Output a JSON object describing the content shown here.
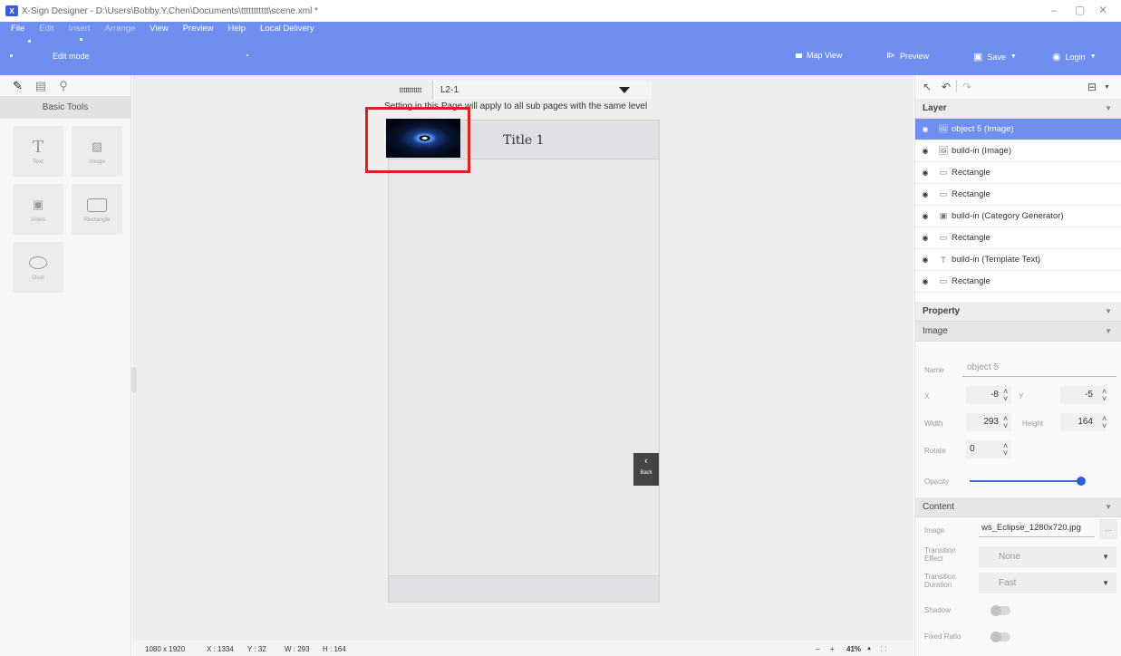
{
  "window": {
    "title": "X-Sign Designer - D:\\Users\\Bobby.Y.Chen\\Documents\\ttttttttttt\\scene.xml *",
    "controls": {
      "minimize": "–",
      "maximize": "▢",
      "close": "✕"
    }
  },
  "menu": {
    "items": [
      "File",
      "Edit",
      "Insert",
      "Arrange",
      "View",
      "Preview",
      "Help",
      "Local Delivery"
    ],
    "mode_label": "Edit mode"
  },
  "header_actions": {
    "map_view": "Map View",
    "preview": "Preview",
    "save": "Save",
    "login": "Login"
  },
  "toolbox": {
    "section_title": "Basic Tools",
    "tools": [
      "Text",
      "Image",
      "Video",
      "Rectangle",
      "Oval"
    ]
  },
  "canvas": {
    "page_prefix": "ttttttttttt",
    "page_selected": "L2-1",
    "note": "Setting in this Page will apply to all sub pages with the same level",
    "phone_title": "Title 1",
    "back_label": "Back"
  },
  "statusbar": {
    "resolution": "1080 x 1920",
    "x": "X : 1334",
    "y": "Y : 32",
    "w": "W : 293",
    "h": "H : 164",
    "zoom_minus": "–",
    "zoom_plus": "+",
    "zoom": "41%",
    "zoom_up": "▲",
    "fit": "⛶"
  },
  "layer_panel": {
    "title": "Layer",
    "layers": [
      {
        "name": "object 5 (Image)",
        "icon": "🖼",
        "selected": true
      },
      {
        "name": "build-in (Image)",
        "icon": "🖼",
        "selected": false
      },
      {
        "name": "Rectangle",
        "icon": "▭",
        "selected": false
      },
      {
        "name": "Rectangle",
        "icon": "▭",
        "selected": false
      },
      {
        "name": "build-in (Category Generator)",
        "icon": "▣",
        "selected": false
      },
      {
        "name": "Rectangle",
        "icon": "▭",
        "selected": false
      },
      {
        "name": "build-in (Template Text)",
        "icon": "T",
        "selected": false
      },
      {
        "name": "Rectangle",
        "icon": "▭",
        "selected": false
      }
    ]
  },
  "property_panel": {
    "title": "Property",
    "image_section": "Image",
    "name_label": "Name",
    "name_value": "object 5",
    "x_label": "X",
    "x_value": "-8",
    "y_label": "Y",
    "y_value": "-5",
    "width_label": "Width",
    "width_value": "293",
    "height_label": "Height",
    "height_value": "164",
    "rotate_label": "Rotate",
    "rotate_value": "0",
    "opacity_label": "Opacity",
    "opacity_value": 1.0
  },
  "content_panel": {
    "title": "Content",
    "image_label": "Image",
    "image_value": "ws_Eclipse_1280x720.jpg",
    "browse_label": "...",
    "transition_effect_label": "Transition Effect",
    "transition_effect_value": "None",
    "transition_duration_label": "Transition Duration",
    "transition_duration_value": "Fast",
    "shadow_label": "Shadow",
    "fixed_ratio_label": "Fixed Ratio"
  },
  "colors": {
    "accent": "#6f8ff0",
    "highlight": "#e02020"
  }
}
